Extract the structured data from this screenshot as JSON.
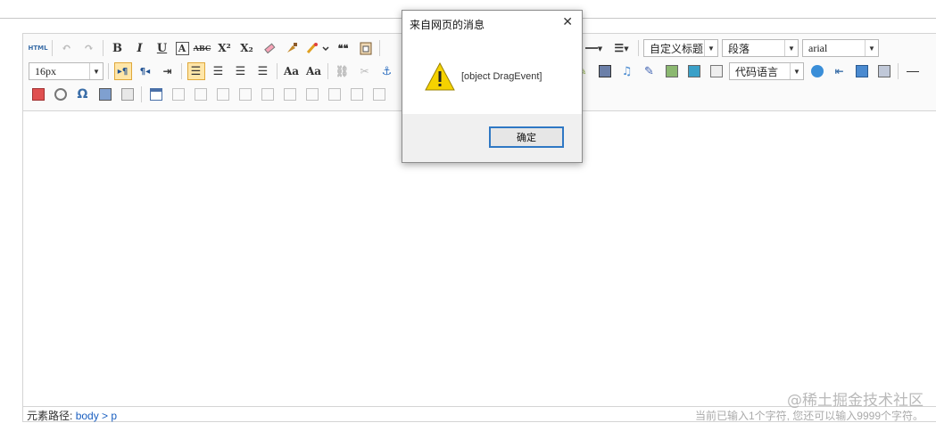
{
  "toolbar": {
    "source_button": "HTML",
    "bold": "B",
    "italic": "I",
    "underline": "U",
    "fontborder": "A",
    "strike": "ABC",
    "superscript": "X²",
    "subscript": "X₂",
    "blockquote": "❝❝",
    "custom_heading": "自定义标题",
    "paragraph": "段落",
    "font_family": "arial",
    "font_size": "16px",
    "code_language": "代码语言",
    "ltr": "▸¶",
    "rtl": "¶◂"
  },
  "status": {
    "path_label": "元素路径:",
    "path_value": "body > p",
    "count_text": "当前已输入1个字符, 您还可以输入9999个字符。"
  },
  "watermark": "@稀土掘金技术社区",
  "dialog": {
    "title": "来自网页的消息",
    "close": "✕",
    "message": "[object DragEvent]",
    "ok_label": "确定"
  },
  "colors": {
    "accent": "#2f78c4",
    "warning": "#f5d200",
    "active_button": "#ffe6a8"
  }
}
